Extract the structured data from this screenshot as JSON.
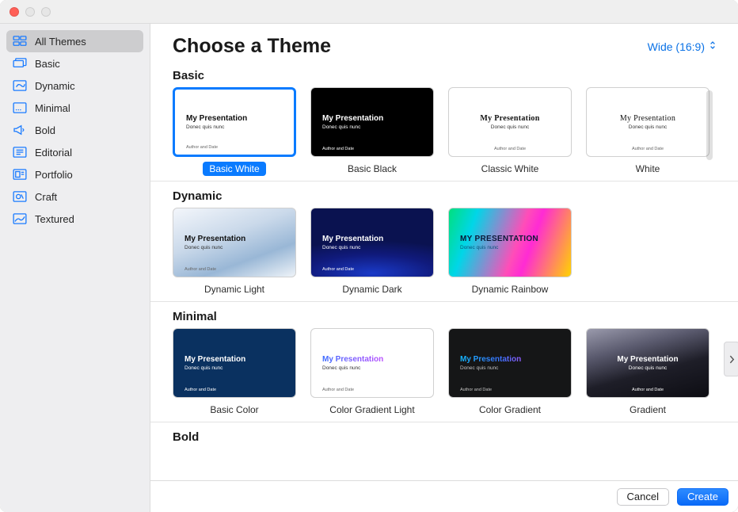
{
  "header": {
    "title": "Choose a Theme",
    "aspect_label": "Wide (16:9)"
  },
  "sidebar": {
    "items": [
      {
        "label": "All Themes",
        "icon": "grid"
      },
      {
        "label": "Basic",
        "icon": "layers"
      },
      {
        "label": "Dynamic",
        "icon": "dynamic"
      },
      {
        "label": "Minimal",
        "icon": "caption"
      },
      {
        "label": "Bold",
        "icon": "megaphone"
      },
      {
        "label": "Editorial",
        "icon": "editorial"
      },
      {
        "label": "Portfolio",
        "icon": "portfolio"
      },
      {
        "label": "Craft",
        "icon": "craft"
      },
      {
        "label": "Textured",
        "icon": "textured"
      }
    ],
    "selected_index": 0
  },
  "sections": {
    "basic": {
      "title": "Basic",
      "themes": [
        {
          "label": "Basic White",
          "selected": true
        },
        {
          "label": "Basic Black"
        },
        {
          "label": "Classic White"
        },
        {
          "label": "White"
        }
      ]
    },
    "dynamic": {
      "title": "Dynamic",
      "themes": [
        {
          "label": "Dynamic Light"
        },
        {
          "label": "Dynamic Dark"
        },
        {
          "label": "Dynamic Rainbow"
        }
      ]
    },
    "minimal": {
      "title": "Minimal",
      "themes": [
        {
          "label": "Basic Color"
        },
        {
          "label": "Color Gradient Light"
        },
        {
          "label": "Color Gradient"
        },
        {
          "label": "Gradient"
        }
      ]
    },
    "bold": {
      "title": "Bold"
    }
  },
  "thumb_text": {
    "title": "My Presentation",
    "title_upper": "MY PRESENTATION",
    "subtitle": "Donec quis nunc",
    "footer": "Author and Date"
  },
  "footer": {
    "cancel": "Cancel",
    "create": "Create"
  }
}
